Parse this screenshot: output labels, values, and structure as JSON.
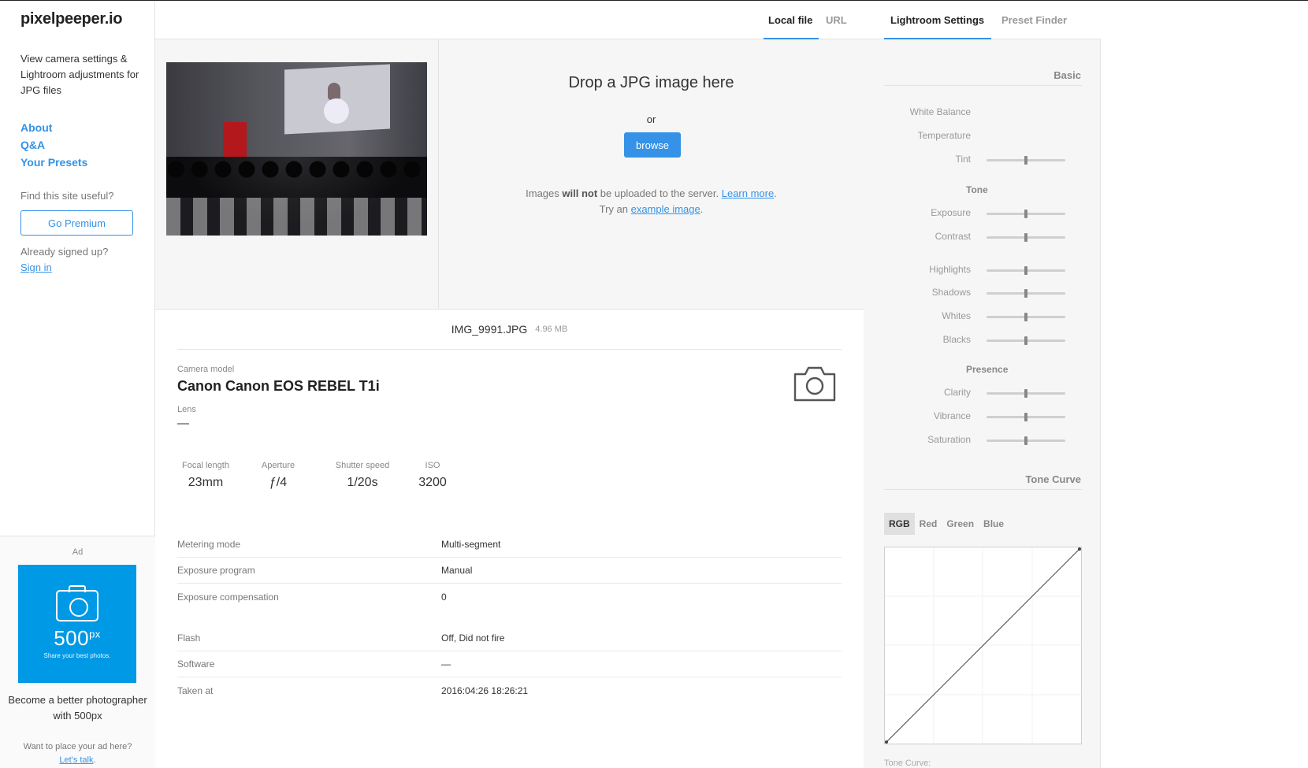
{
  "sidebar": {
    "logo": "pixelpeeper.io",
    "tagline": "View camera settings & Lightroom adjustments for JPG files",
    "links": [
      "About",
      "Q&A",
      "Your Presets"
    ],
    "useful_text": "Find this site useful?",
    "premium_label": "Go Premium",
    "signed_text": "Already signed up?",
    "signin_label": "Sign in",
    "ad": {
      "label": "Ad",
      "brand": "500",
      "brand_sup": "px",
      "slogan": "Share your best photos.",
      "text": "Become a better photographer with 500px",
      "place_text": "Want to place your ad here?",
      "place_link": "Let's talk",
      "place_end": ".",
      "color": "#0099e5"
    }
  },
  "main": {
    "tabs": [
      "Local file",
      "URL"
    ],
    "drop": {
      "title": "Drop a JPG image here",
      "or": "or",
      "browse": "browse",
      "note_pre": "Images ",
      "note_bold": "will not",
      "note_mid": " be uploaded to the server. ",
      "note_link": "Learn more",
      "note_end": ".",
      "try_pre": "Try an ",
      "try_link": "example image",
      "try_end": "."
    },
    "file": {
      "name": "IMG_9991.JPG",
      "size": "4.96 MB"
    },
    "camera_label": "Camera model",
    "camera_value": "Canon Canon EOS REBEL T1i",
    "lens_label": "Lens",
    "lens_value": "—",
    "specs": [
      {
        "label": "Focal length",
        "value": "23mm"
      },
      {
        "label": "Aperture",
        "value": "ƒ/4"
      },
      {
        "label": "Shutter speed",
        "value": "1/20s"
      },
      {
        "label": "ISO",
        "value": "3200"
      }
    ],
    "details": [
      {
        "key": "Metering mode",
        "value": "Multi-segment"
      },
      {
        "key": "Exposure program",
        "value": "Manual"
      },
      {
        "key": "Exposure compensation",
        "value": "0"
      },
      {
        "key": "Flash",
        "value": "Off, Did not fire"
      },
      {
        "key": "Software",
        "value": "—"
      },
      {
        "key": "Taken at",
        "value": "2016:04:26 18:26:21"
      }
    ]
  },
  "right": {
    "tabs": [
      "Lightroom Settings",
      "Preset Finder"
    ],
    "basic_title": "Basic",
    "white_balance": "White Balance",
    "temperature": "Temperature",
    "tint": {
      "label": "Tint",
      "value": 0.5
    },
    "tone_title": "Tone",
    "tone": [
      {
        "label": "Exposure",
        "value": 0.5
      },
      {
        "label": "Contrast",
        "value": 0.5
      },
      {
        "label": "Highlights",
        "value": 0.5
      },
      {
        "label": "Shadows",
        "value": 0.5
      },
      {
        "label": "Whites",
        "value": 0.5
      },
      {
        "label": "Blacks",
        "value": 0.5
      }
    ],
    "presence_title": "Presence",
    "presence": [
      {
        "label": "Clarity",
        "value": 0.5
      },
      {
        "label": "Vibrance",
        "value": 0.5
      },
      {
        "label": "Saturation",
        "value": 0.5
      }
    ],
    "curve_title": "Tone Curve",
    "curve_tabs": [
      "RGB",
      "Red",
      "Green",
      "Blue"
    ],
    "curve_footer": "Tone Curve:"
  },
  "colors": {
    "accent": "#3592e6"
  }
}
